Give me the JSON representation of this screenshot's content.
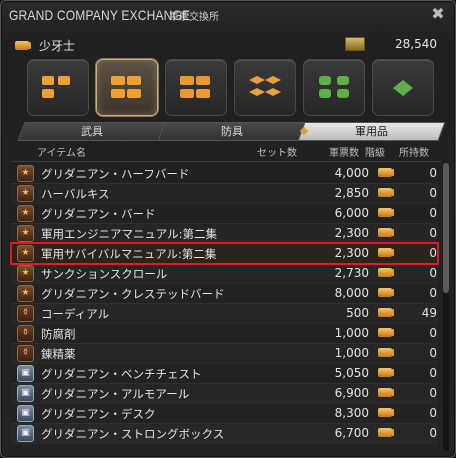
{
  "window": {
    "title": "GRAND COMPANY EXCHANGE",
    "subtitle": "軍票交換所",
    "close_label": "✖"
  },
  "player": {
    "rank": "少牙士",
    "seals": "28,540"
  },
  "categories": [
    {
      "name": "rank-1-tier"
    },
    {
      "name": "rank-2-tier"
    },
    {
      "name": "rank-3-tier"
    },
    {
      "name": "special-1"
    },
    {
      "name": "special-2"
    },
    {
      "name": "special-3"
    }
  ],
  "tabs": [
    {
      "label": "武具"
    },
    {
      "label": "防具"
    },
    {
      "label": "軍用品"
    }
  ],
  "table": {
    "headers": {
      "name": "アイテム名",
      "set": "セット数",
      "cost": "軍票数",
      "rank": "階級",
      "held": "所持数"
    },
    "rows": [
      {
        "icon": "star",
        "name": "グリダニアン・ハーフバード",
        "cost": "4,000",
        "held": "0"
      },
      {
        "icon": "star",
        "name": "ハーバルキス",
        "cost": "2,850",
        "held": "0"
      },
      {
        "icon": "star",
        "name": "グリダニアン・バード",
        "cost": "6,000",
        "held": "0"
      },
      {
        "icon": "star",
        "name": "軍用エンジニアマニュアル:第二集",
        "cost": "2,300",
        "held": "0"
      },
      {
        "icon": "star",
        "name": "軍用サバイバルマニュアル:第二集",
        "cost": "2,300",
        "held": "0"
      },
      {
        "icon": "star",
        "name": "サンクションスクロール",
        "cost": "2,730",
        "held": "0"
      },
      {
        "icon": "star",
        "name": "グリダニアン・クレステッドバード",
        "cost": "8,000",
        "held": "0"
      },
      {
        "icon": "bottle",
        "name": "コーディアル",
        "cost": "500",
        "held": "49"
      },
      {
        "icon": "bottle",
        "name": "防腐剤",
        "cost": "1,000",
        "held": "0"
      },
      {
        "icon": "bottle",
        "name": "錬精薬",
        "cost": "1,000",
        "held": "0"
      },
      {
        "icon": "furniture",
        "name": "グリダニアン・ベンチチェスト",
        "cost": "5,050",
        "held": "0"
      },
      {
        "icon": "furniture",
        "name": "グリダニアン・アルモアール",
        "cost": "6,900",
        "held": "0"
      },
      {
        "icon": "furniture",
        "name": "グリダニアン・デスク",
        "cost": "8,300",
        "held": "0"
      },
      {
        "icon": "furniture",
        "name": "グリダニアン・ストロングボックス",
        "cost": "6,700",
        "held": "0"
      }
    ]
  },
  "colors": {
    "accent": "#e0a030",
    "selection": "#e01a1a"
  }
}
